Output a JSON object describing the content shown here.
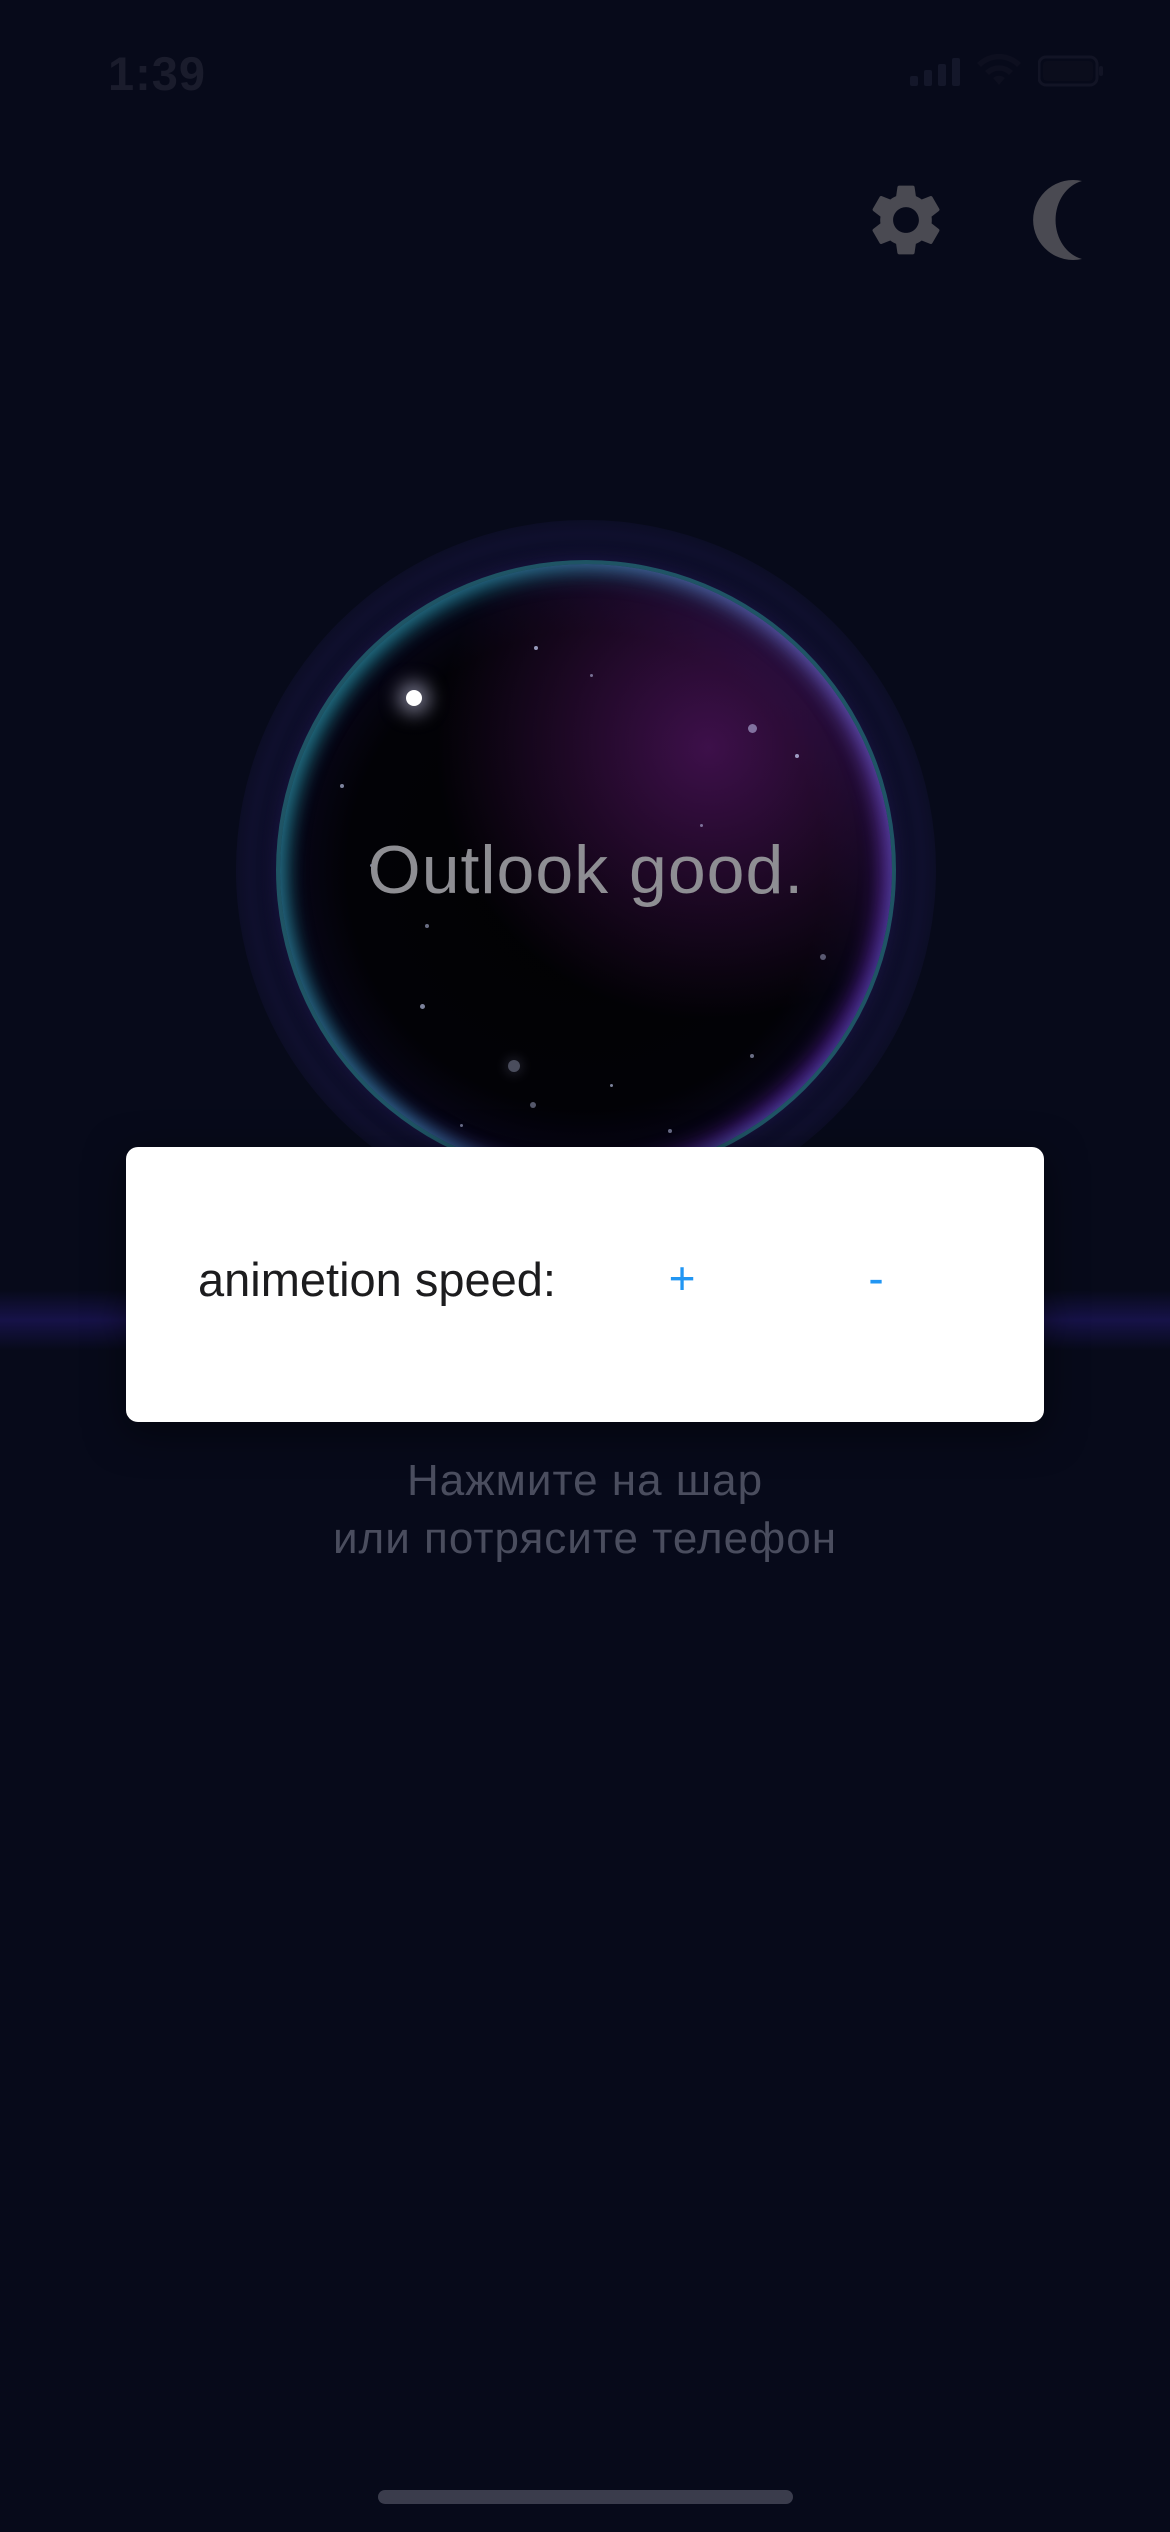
{
  "status_bar": {
    "time": "1:39"
  },
  "actions": {
    "settings_icon": "gear-icon",
    "theme_icon": "moon-icon"
  },
  "orb": {
    "answer": "Outlook good."
  },
  "dialog": {
    "label": "animetion speed:",
    "plus_label": "+",
    "minus_label": "-"
  },
  "hint": {
    "line1": "Нажмите на шар",
    "line2": "или потрясите телефон"
  },
  "colors": {
    "background": "#070a1a",
    "accent": "#2196f3",
    "icon": "#4a4a52"
  }
}
